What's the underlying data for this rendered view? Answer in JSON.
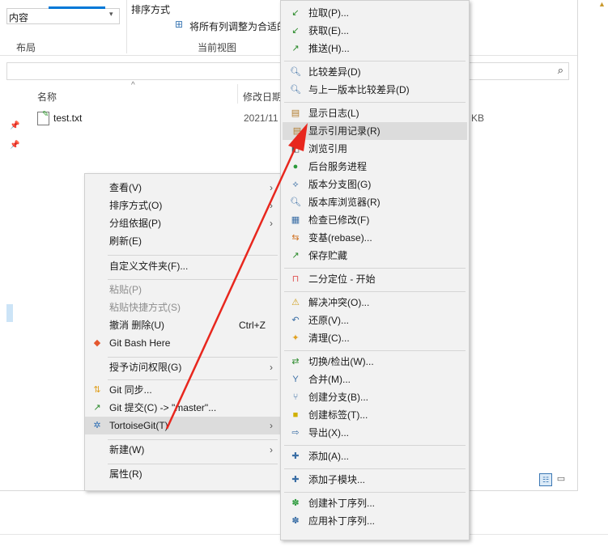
{
  "ribbon": {
    "pane_label": "内容",
    "sort_label": "排序方式",
    "fit_label": "将所有列调整为合适的",
    "layout_group": "布局",
    "view_group": "当前视图"
  },
  "file_list": {
    "col_name": "名称",
    "col_date": "修改日期",
    "file_name": "test.txt",
    "file_date": "2021/11",
    "file_size": "KB"
  },
  "context_menu": {
    "items": [
      {
        "label": "查看(V)"
      },
      {
        "label": "排序方式(O)"
      },
      {
        "label": "分组依据(P)"
      },
      {
        "label": "刷新(E)"
      },
      {
        "label": "自定义文件夹(F)..."
      },
      {
        "label": "粘贴(P)"
      },
      {
        "label": "粘贴快捷方式(S)"
      },
      {
        "label": "撤消 删除(U)",
        "shortcut": "Ctrl+Z"
      },
      {
        "label": "Git Bash Here"
      },
      {
        "label": "授予访问权限(G)"
      },
      {
        "label": "Git 同步..."
      },
      {
        "label": "Git 提交(C) -> \"master\"..."
      },
      {
        "label": "TortoiseGit(T)"
      },
      {
        "label": "新建(W)"
      },
      {
        "label": "属性(R)"
      }
    ]
  },
  "tortoise_menu": {
    "items": [
      {
        "label": "拉取(P)..."
      },
      {
        "label": "获取(E)..."
      },
      {
        "label": "推送(H)..."
      },
      {
        "label": "比较差异(D)"
      },
      {
        "label": "与上一版本比较差异(D)"
      },
      {
        "label": "显示日志(L)"
      },
      {
        "label": "显示引用记录(R)"
      },
      {
        "label": "浏览引用"
      },
      {
        "label": "后台服务进程"
      },
      {
        "label": "版本分支图(G)"
      },
      {
        "label": "版本库浏览器(R)"
      },
      {
        "label": "检查已修改(F)"
      },
      {
        "label": "变基(rebase)..."
      },
      {
        "label": "保存贮藏"
      },
      {
        "label": "二分定位 - 开始"
      },
      {
        "label": "解决冲突(O)..."
      },
      {
        "label": "还原(V)..."
      },
      {
        "label": "清理(C)..."
      },
      {
        "label": "切换/检出(W)..."
      },
      {
        "label": "合并(M)..."
      },
      {
        "label": "创建分支(B)..."
      },
      {
        "label": "创建标签(T)..."
      },
      {
        "label": "导出(X)..."
      },
      {
        "label": "添加(A)..."
      },
      {
        "label": "添加子模块..."
      },
      {
        "label": "创建补丁序列..."
      },
      {
        "label": "应用补丁序列..."
      }
    ]
  },
  "colors": {
    "arrow": "#e8271e",
    "highlight": "#dcdcdc",
    "menu_bg": "#f2f2f2"
  }
}
